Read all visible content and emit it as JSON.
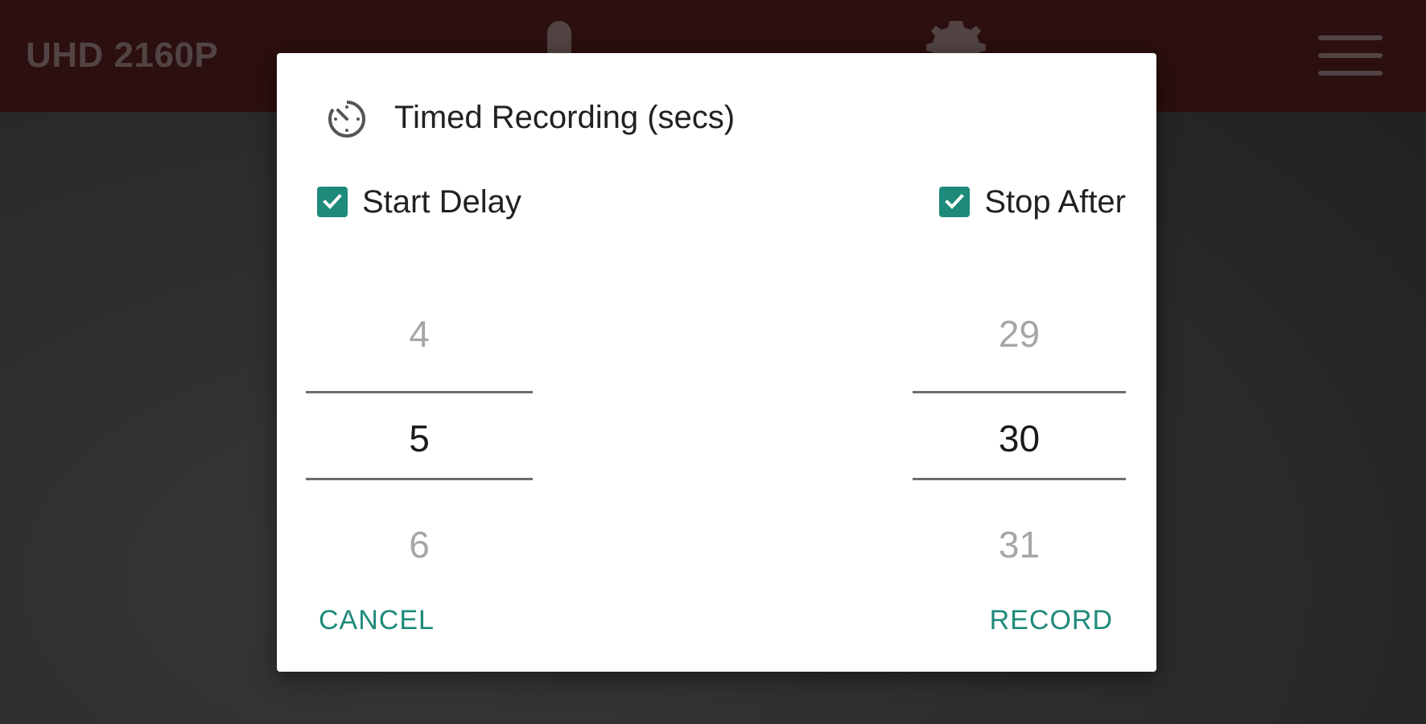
{
  "topbar": {
    "resolution_label": "UHD 2160P",
    "icons": [
      "mic-icon",
      "gear-icon",
      "menu-icon"
    ]
  },
  "dialog": {
    "title": "Timed Recording (secs)",
    "title_icon": "timer-icon",
    "start_delay": {
      "label": "Start Delay",
      "checked": true,
      "prev": "4",
      "value": "5",
      "next": "6"
    },
    "stop_after": {
      "label": "Stop After",
      "checked": true,
      "prev": "29",
      "value": "30",
      "next": "31"
    },
    "cancel_label": "CANCEL",
    "record_label": "RECORD"
  },
  "colors": {
    "accent": "#1e8a7a",
    "topbar": "#3b1414",
    "dialog_bg": "#ffffff"
  }
}
